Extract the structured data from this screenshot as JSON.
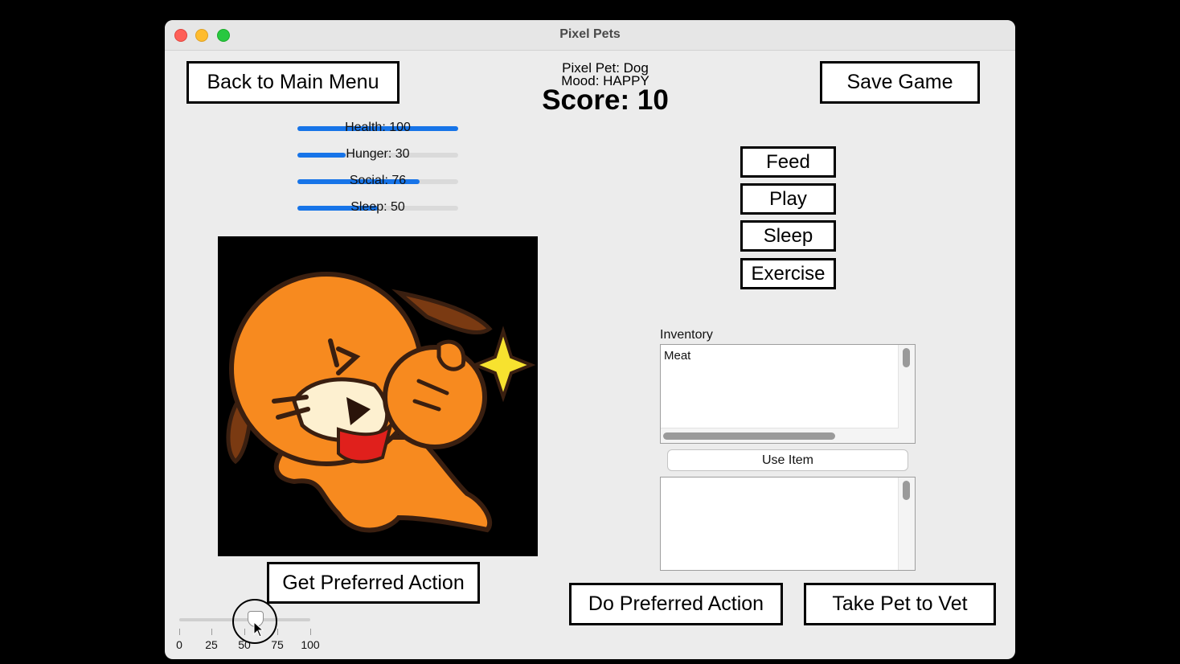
{
  "window": {
    "title": "Pixel Pets"
  },
  "header": {
    "back_label": "Back to Main Menu",
    "save_label": "Save Game",
    "pet_line": "Pixel Pet: Dog",
    "mood_line": "Mood: HAPPY",
    "score_line": "Score: 10"
  },
  "stats": [
    {
      "label": "Health: 100",
      "value": 100
    },
    {
      "label": "Hunger: 30",
      "value": 30
    },
    {
      "label": "Social: 76",
      "value": 76
    },
    {
      "label": "Sleep: 50",
      "value": 50
    }
  ],
  "actions": {
    "feed": "Feed",
    "play": "Play",
    "sleep": "Sleep",
    "exercise": "Exercise"
  },
  "inventory": {
    "label": "Inventory",
    "items": [
      "Meat"
    ],
    "use_label": "Use Item"
  },
  "bottom": {
    "get_preferred": "Get Preferred Action",
    "do_preferred": "Do Preferred Action",
    "vet": "Take Pet to Vet"
  },
  "slider": {
    "value": 50,
    "ticks": [
      "0",
      "25",
      "50",
      "75",
      "100"
    ]
  },
  "colors": {
    "accent": "#1774e8",
    "dog_orange": "#f78a1f",
    "bandana": "#e0201c",
    "sparkle": "#f7e22f"
  }
}
